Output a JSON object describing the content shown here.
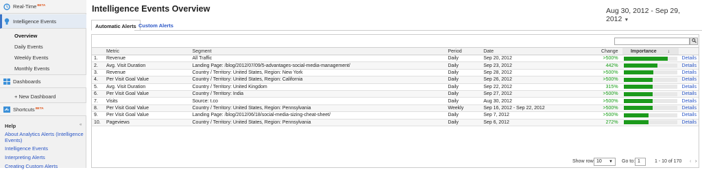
{
  "sidebar": {
    "realtime": {
      "label": "Real-Time",
      "badge": "BETA"
    },
    "intelligence": {
      "label": "Intelligence Events"
    },
    "sub_items": [
      "Overview",
      "Daily Events",
      "Weekly Events",
      "Monthly Events"
    ],
    "dashboards": {
      "label": "Dashboards"
    },
    "new_dashboard": "+ New Dashboard",
    "shortcuts": {
      "label": "Shortcuts",
      "badge": "BETA"
    },
    "help_heading": "Help",
    "collapse_glyph": "«",
    "help_links": [
      "About Analytics Alerts (Intelligence Events)",
      "Intelligence Events",
      "Interpreting Alerts",
      "Creating Custom Alerts"
    ]
  },
  "header": {
    "title": "Intelligence Events Overview",
    "date_range": "Aug 30, 2012 - Sep 29, 2012"
  },
  "tabs": [
    "Automatic Alerts",
    "Custom Alerts"
  ],
  "search": {
    "placeholder": ""
  },
  "table": {
    "columns": {
      "num": "",
      "metric": "Metric",
      "segment": "Segment",
      "period": "Period",
      "date": "Date",
      "change": "Change",
      "importance": "Importance",
      "sort_glyph": "↓",
      "details": ""
    },
    "rows": [
      {
        "num": "1.",
        "metric": "Revenue",
        "segment": "All Traffic",
        "period": "Daily",
        "date": "Sep 20, 2012",
        "change": ">500%",
        "importance": 0.82,
        "details": "Details"
      },
      {
        "num": "2.",
        "metric": "Avg. Visit Duration",
        "segment": "Landing Page: /blog/2012/07/09/5-advantages-social-media-management/",
        "period": "Daily",
        "date": "Sep 23, 2012",
        "change": "442%",
        "importance": 0.64,
        "details": "Details"
      },
      {
        "num": "3.",
        "metric": "Revenue",
        "segment": "Country / Territory: United States, Region: New York",
        "period": "Daily",
        "date": "Sep 28, 2012",
        "change": ">500%",
        "importance": 0.56,
        "details": "Details"
      },
      {
        "num": "4.",
        "metric": "Per Visit Goal Value",
        "segment": "Country / Territory: United States, Region: California",
        "period": "Daily",
        "date": "Sep 26, 2012",
        "change": ">500%",
        "importance": 0.55,
        "details": "Details"
      },
      {
        "num": "5.",
        "metric": "Avg. Visit Duration",
        "segment": "Country / Territory: United Kingdom",
        "period": "Daily",
        "date": "Sep 22, 2012",
        "change": "315%",
        "importance": 0.55,
        "details": "Details"
      },
      {
        "num": "6.",
        "metric": "Per Visit Goal Value",
        "segment": "Country / Territory: India",
        "period": "Daily",
        "date": "Sep 27, 2012",
        "change": ">500%",
        "importance": 0.55,
        "details": "Details"
      },
      {
        "num": "7.",
        "metric": "Visits",
        "segment": "Source: t.co",
        "period": "Daily",
        "date": "Aug 30, 2012",
        "change": ">500%",
        "importance": 0.55,
        "details": "Details"
      },
      {
        "num": "8.",
        "metric": "Per Visit Goal Value",
        "segment": "Country / Territory: United States, Region: Pennsylvania",
        "period": "Weekly",
        "date": "Sep 16, 2012 - Sep 22, 2012",
        "change": ">500%",
        "importance": 0.55,
        "details": "Details"
      },
      {
        "num": "9.",
        "metric": "Per Visit Goal Value",
        "segment": "Landing Page: /blog/2012/06/18/social-media-sizing-cheat-sheet/",
        "period": "Daily",
        "date": "Sep 7, 2012",
        "change": ">500%",
        "importance": 0.47,
        "details": "Details"
      },
      {
        "num": "10.",
        "metric": "Pageviews",
        "segment": "Country / Territory: United States, Region: Pennsylvania",
        "period": "Daily",
        "date": "Sep 6, 2012",
        "change": "272%",
        "importance": 0.47,
        "details": "Details"
      }
    ]
  },
  "footer": {
    "show_rows_label": "Show rows:",
    "show_rows_value": "10",
    "goto_label": "Go to:",
    "goto_value": "1",
    "range": "1 - 10 of 170"
  },
  "colors": {
    "link": "#2a56c6",
    "positive": "#149c14",
    "bar": "#1c9a1c",
    "beta": "#e0551a"
  }
}
